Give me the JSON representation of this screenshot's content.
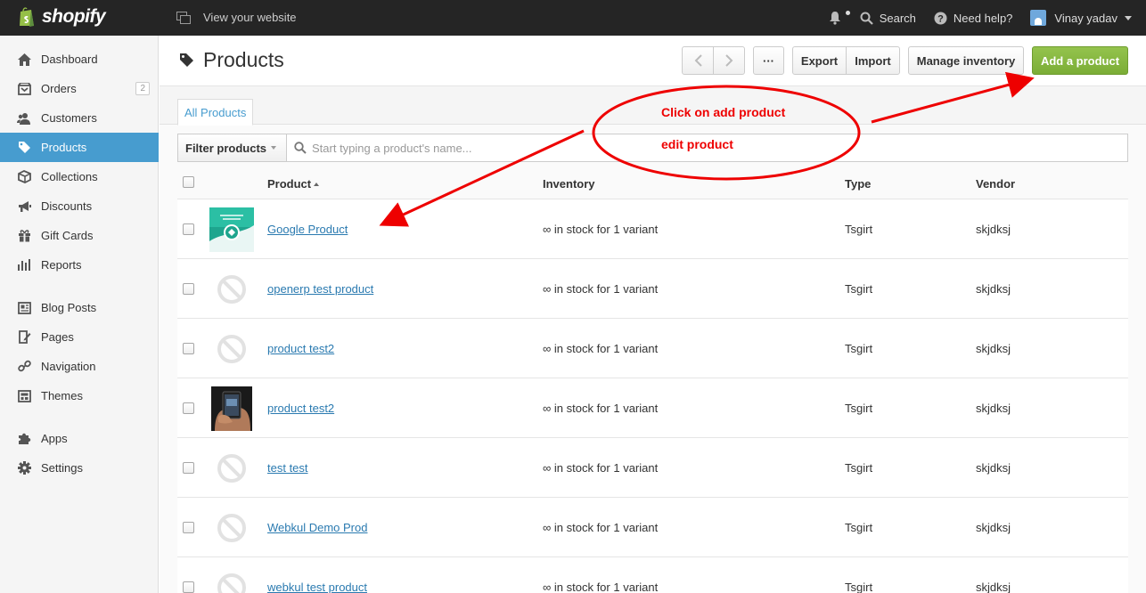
{
  "topbar": {
    "brand": "shopify",
    "view_site": "View your website",
    "search": "Search",
    "help": "Need help?",
    "user": "Vinay yadav"
  },
  "sidebar": {
    "items": [
      {
        "label": "Dashboard",
        "icon": "home-icon"
      },
      {
        "label": "Orders",
        "icon": "orders-icon",
        "badge": "2"
      },
      {
        "label": "Customers",
        "icon": "customers-icon"
      },
      {
        "label": "Products",
        "icon": "tag-icon",
        "active": true
      },
      {
        "label": "Collections",
        "icon": "collections-icon"
      },
      {
        "label": "Discounts",
        "icon": "megaphone-icon"
      },
      {
        "label": "Gift Cards",
        "icon": "gift-icon"
      },
      {
        "label": "Reports",
        "icon": "bar-chart-icon"
      },
      {
        "label": "Blog Posts",
        "icon": "newspaper-icon"
      },
      {
        "label": "Pages",
        "icon": "pages-icon"
      },
      {
        "label": "Navigation",
        "icon": "link-icon"
      },
      {
        "label": "Themes",
        "icon": "themes-icon"
      },
      {
        "label": "Apps",
        "icon": "puzzle-icon"
      },
      {
        "label": "Settings",
        "icon": "gear-icon"
      }
    ]
  },
  "header": {
    "title": "Products",
    "more": "···",
    "export": "Export",
    "import": "Import",
    "manage_inventory": "Manage inventory",
    "add_product": "Add a product"
  },
  "tabs": {
    "all_products": "All Products"
  },
  "filter": {
    "label": "Filter products",
    "placeholder": "Start typing a product's name..."
  },
  "table": {
    "columns": {
      "product": "Product",
      "inventory": "Inventory",
      "type": "Type",
      "vendor": "Vendor"
    },
    "rows": [
      {
        "name": "Google Product",
        "inventory": "∞ in stock for 1 variant",
        "type": "Tsgirt",
        "vendor": "skjdksj",
        "thumb": "google-product-image"
      },
      {
        "name": "openerp test product",
        "inventory": "∞ in stock for 1 variant",
        "type": "Tsgirt",
        "vendor": "skjdksj",
        "thumb": "no-image-icon"
      },
      {
        "name": "product test2",
        "inventory": "∞ in stock for 1 variant",
        "type": "Tsgirt",
        "vendor": "skjdksj",
        "thumb": "no-image-icon"
      },
      {
        "name": "product test2",
        "inventory": "∞ in stock for 1 variant",
        "type": "Tsgirt",
        "vendor": "skjdksj",
        "thumb": "phone-hand-image"
      },
      {
        "name": "test test",
        "inventory": "∞ in stock for 1 variant",
        "type": "Tsgirt",
        "vendor": "skjdksj",
        "thumb": "no-image-icon"
      },
      {
        "name": "Webkul Demo Prod",
        "inventory": "∞ in stock for 1 variant",
        "type": "Tsgirt",
        "vendor": "skjdksj",
        "thumb": "no-image-icon"
      },
      {
        "name": "webkul test product",
        "inventory": "∞ in stock for 1 variant",
        "type": "Tsgirt",
        "vendor": "skjdksj",
        "thumb": "no-image-icon"
      }
    ]
  },
  "annotation": {
    "line1": "Click on add product",
    "line2": "edit product",
    "color": "#e00000"
  },
  "colors": {
    "topbar": "#252525",
    "active_nav": "#479ccf",
    "primary_button": "#7bad36",
    "link": "#2a7ab0"
  }
}
